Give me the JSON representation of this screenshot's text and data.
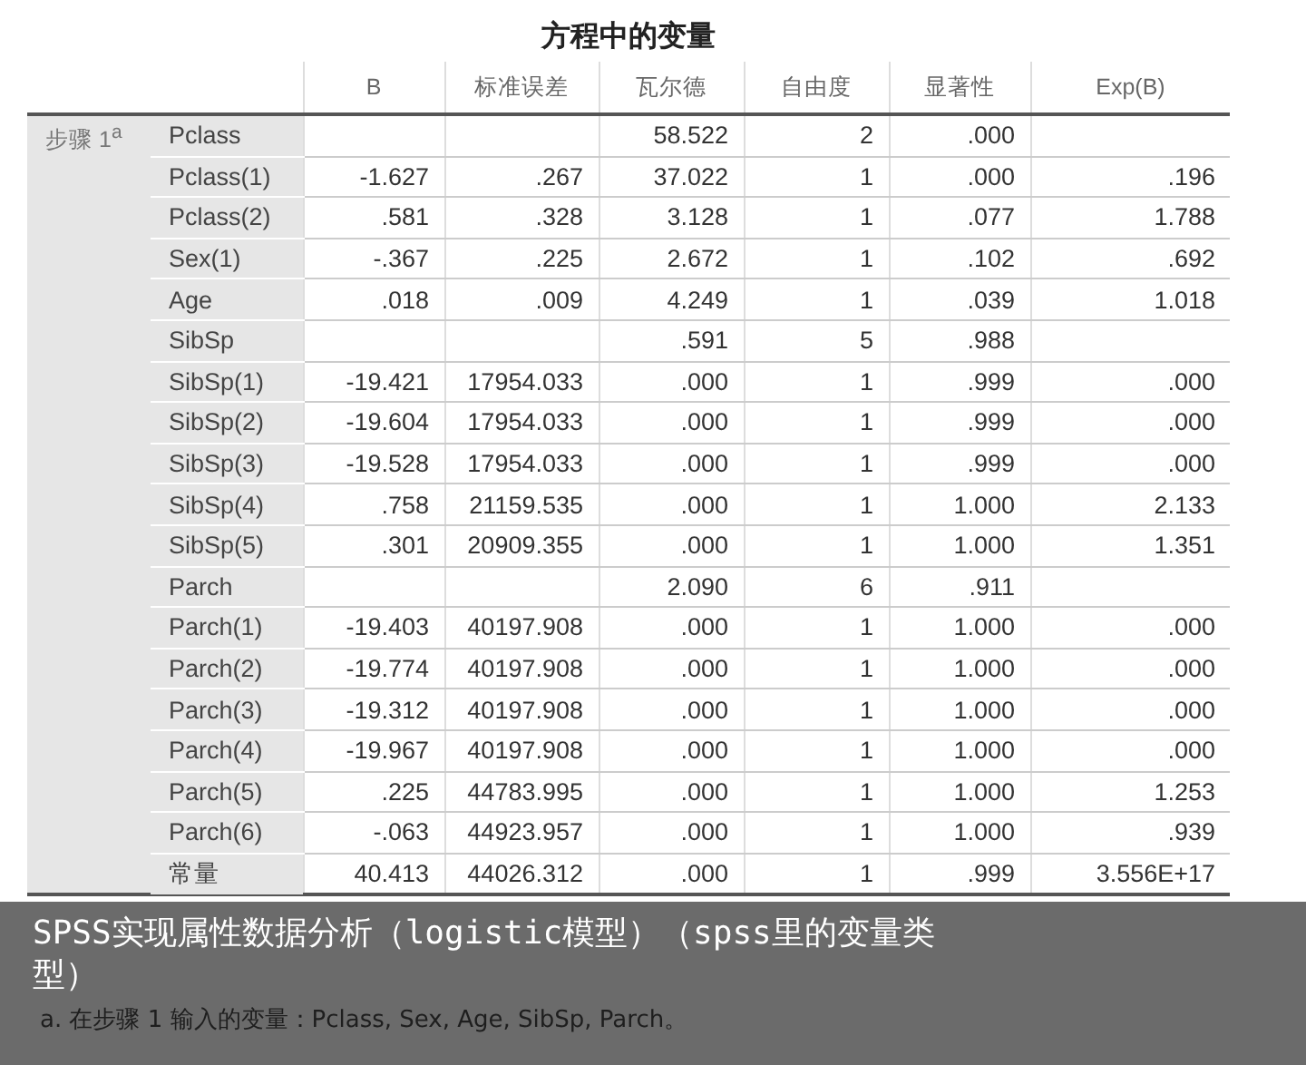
{
  "table": {
    "title": "方程中的变量",
    "columns": [
      "B",
      "标准误差",
      "瓦尔德",
      "自由度",
      "显著性",
      "Exp(B)"
    ],
    "step_label": "步骤 1$^{a}$",
    "rows": [
      {
        "variable": "Pclass",
        "cells": [
          null,
          null,
          "58.522",
          "2",
          ".000",
          null
        ]
      },
      {
        "variable": "Pclass(1)",
        "cells": [
          "-1.627",
          ".267",
          "37.022",
          "1",
          ".000",
          ".196"
        ]
      },
      {
        "variable": "Pclass(2)",
        "cells": [
          ".581",
          ".328",
          "3.128",
          "1",
          ".077",
          "1.788"
        ]
      },
      {
        "variable": "Sex(1)",
        "cells": [
          "-.367",
          ".225",
          "2.672",
          "1",
          ".102",
          ".692"
        ]
      },
      {
        "variable": "Age",
        "cells": [
          ".018",
          ".009",
          "4.249",
          "1",
          ".039",
          "1.018"
        ]
      },
      {
        "variable": "SibSp",
        "cells": [
          null,
          null,
          ".591",
          "5",
          ".988",
          null
        ]
      },
      {
        "variable": "SibSp(1)",
        "cells": [
          "-19.421",
          "17954.033",
          ".000",
          "1",
          ".999",
          ".000"
        ]
      },
      {
        "variable": "SibSp(2)",
        "cells": [
          "-19.604",
          "17954.033",
          ".000",
          "1",
          ".999",
          ".000"
        ]
      },
      {
        "variable": "SibSp(3)",
        "cells": [
          "-19.528",
          "17954.033",
          ".000",
          "1",
          ".999",
          ".000"
        ]
      },
      {
        "variable": "SibSp(4)",
        "cells": [
          ".758",
          "21159.535",
          ".000",
          "1",
          "1.000",
          "2.133"
        ]
      },
      {
        "variable": "SibSp(5)",
        "cells": [
          ".301",
          "20909.355",
          ".000",
          "1",
          "1.000",
          "1.351"
        ]
      },
      {
        "variable": "Parch",
        "cells": [
          null,
          null,
          "2.090",
          "6",
          ".911",
          null
        ]
      },
      {
        "variable": "Parch(1)",
        "cells": [
          "-19.403",
          "40197.908",
          ".000",
          "1",
          "1.000",
          ".000"
        ]
      },
      {
        "variable": "Parch(2)",
        "cells": [
          "-19.774",
          "40197.908",
          ".000",
          "1",
          "1.000",
          ".000"
        ]
      },
      {
        "variable": "Parch(3)",
        "cells": [
          "-19.312",
          "40197.908",
          ".000",
          "1",
          "1.000",
          ".000"
        ]
      },
      {
        "variable": "Parch(4)",
        "cells": [
          "-19.967",
          "40197.908",
          ".000",
          "1",
          "1.000",
          ".000"
        ]
      },
      {
        "variable": "Parch(5)",
        "cells": [
          ".225",
          "44783.995",
          ".000",
          "1",
          "1.000",
          "1.253"
        ]
      },
      {
        "variable": "Parch(6)",
        "cells": [
          "-.063",
          "44923.957",
          ".000",
          "1",
          "1.000",
          ".939"
        ]
      },
      {
        "variable": "常量",
        "cells": [
          "40.413",
          "44026.312",
          ".000",
          "1",
          ".999",
          "3.556E+17"
        ]
      }
    ],
    "footnote": "a. 在步骤 1 输入的变量：Pclass, Sex, Age, SibSp, Parch。"
  },
  "caption": "SPSS实现属性数据分析（logistic模型）（spss里的变量类型）"
}
